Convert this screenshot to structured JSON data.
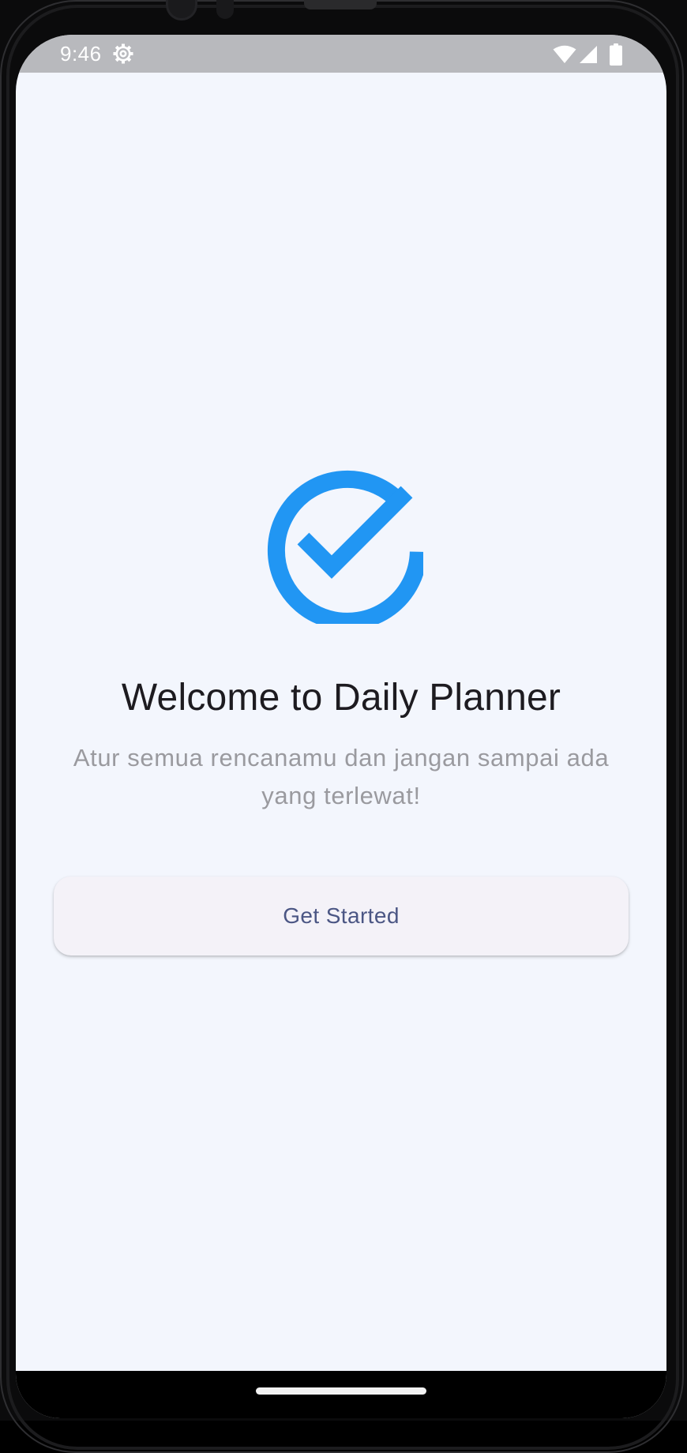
{
  "status_bar": {
    "time": "9:46",
    "icons": [
      "gear-icon",
      "wifi-icon",
      "signal-icon",
      "battery-icon"
    ],
    "text_color": "#ffffff",
    "background": "#b8b9bd"
  },
  "welcome": {
    "logo_icon": "check-circle-icon",
    "logo_color": "#2196f3",
    "title": "Welcome to Daily Planner",
    "subtitle": "Atur semua rencanamu dan jangan sampai ada yang terlewat!",
    "button_label": "Get Started"
  },
  "colors": {
    "screen_background": "#f3f6fd",
    "title_text": "#1d1b20",
    "subtitle_text": "#9a9a9f",
    "button_background": "#f4f2f8",
    "button_text": "#4b5684"
  }
}
